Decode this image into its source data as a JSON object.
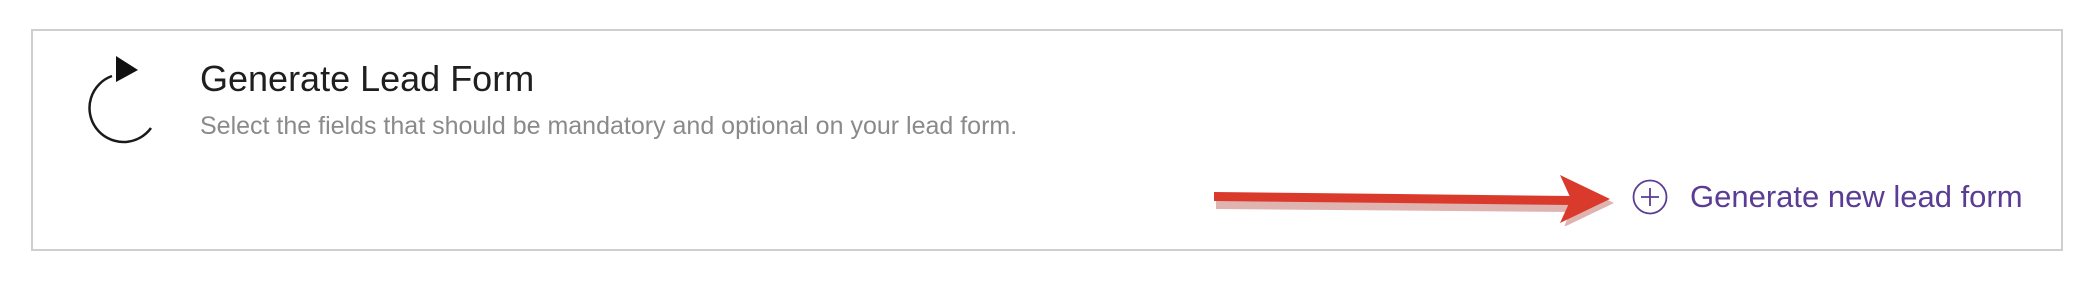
{
  "card": {
    "title": "Generate Lead Form",
    "description": "Select the fields that should be mandatory and optional on your lead form.",
    "icon": "refresh-icon"
  },
  "action": {
    "label": "Generate new lead form",
    "icon": "plus-circle-icon",
    "color": "#5a3c94"
  },
  "annotation": {
    "type": "arrow",
    "color": "#d93a2b"
  }
}
